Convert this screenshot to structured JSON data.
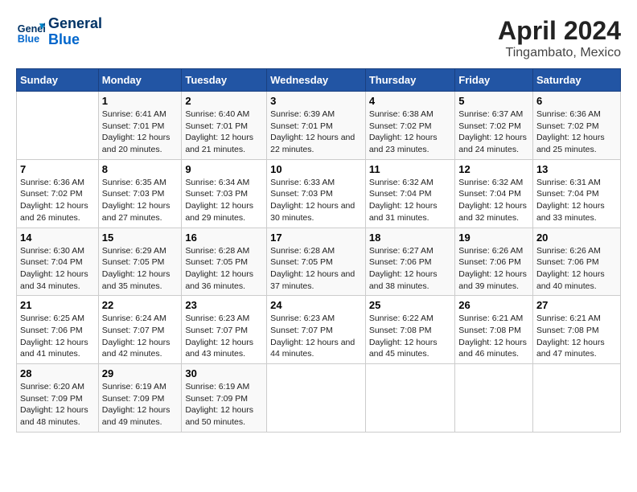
{
  "header": {
    "logo_line1": "General",
    "logo_line2": "Blue",
    "title": "April 2024",
    "subtitle": "Tingambato, Mexico"
  },
  "calendar": {
    "days_of_week": [
      "Sunday",
      "Monday",
      "Tuesday",
      "Wednesday",
      "Thursday",
      "Friday",
      "Saturday"
    ],
    "weeks": [
      [
        {
          "day": "",
          "info": ""
        },
        {
          "day": "1",
          "info": "Sunrise: 6:41 AM\nSunset: 7:01 PM\nDaylight: 12 hours\nand 20 minutes."
        },
        {
          "day": "2",
          "info": "Sunrise: 6:40 AM\nSunset: 7:01 PM\nDaylight: 12 hours\nand 21 minutes."
        },
        {
          "day": "3",
          "info": "Sunrise: 6:39 AM\nSunset: 7:01 PM\nDaylight: 12 hours\nand 22 minutes."
        },
        {
          "day": "4",
          "info": "Sunrise: 6:38 AM\nSunset: 7:02 PM\nDaylight: 12 hours\nand 23 minutes."
        },
        {
          "day": "5",
          "info": "Sunrise: 6:37 AM\nSunset: 7:02 PM\nDaylight: 12 hours\nand 24 minutes."
        },
        {
          "day": "6",
          "info": "Sunrise: 6:36 AM\nSunset: 7:02 PM\nDaylight: 12 hours\nand 25 minutes."
        }
      ],
      [
        {
          "day": "7",
          "info": "Sunrise: 6:36 AM\nSunset: 7:02 PM\nDaylight: 12 hours\nand 26 minutes."
        },
        {
          "day": "8",
          "info": "Sunrise: 6:35 AM\nSunset: 7:03 PM\nDaylight: 12 hours\nand 27 minutes."
        },
        {
          "day": "9",
          "info": "Sunrise: 6:34 AM\nSunset: 7:03 PM\nDaylight: 12 hours\nand 29 minutes."
        },
        {
          "day": "10",
          "info": "Sunrise: 6:33 AM\nSunset: 7:03 PM\nDaylight: 12 hours\nand 30 minutes."
        },
        {
          "day": "11",
          "info": "Sunrise: 6:32 AM\nSunset: 7:04 PM\nDaylight: 12 hours\nand 31 minutes."
        },
        {
          "day": "12",
          "info": "Sunrise: 6:32 AM\nSunset: 7:04 PM\nDaylight: 12 hours\nand 32 minutes."
        },
        {
          "day": "13",
          "info": "Sunrise: 6:31 AM\nSunset: 7:04 PM\nDaylight: 12 hours\nand 33 minutes."
        }
      ],
      [
        {
          "day": "14",
          "info": "Sunrise: 6:30 AM\nSunset: 7:04 PM\nDaylight: 12 hours\nand 34 minutes."
        },
        {
          "day": "15",
          "info": "Sunrise: 6:29 AM\nSunset: 7:05 PM\nDaylight: 12 hours\nand 35 minutes."
        },
        {
          "day": "16",
          "info": "Sunrise: 6:28 AM\nSunset: 7:05 PM\nDaylight: 12 hours\nand 36 minutes."
        },
        {
          "day": "17",
          "info": "Sunrise: 6:28 AM\nSunset: 7:05 PM\nDaylight: 12 hours\nand 37 minutes."
        },
        {
          "day": "18",
          "info": "Sunrise: 6:27 AM\nSunset: 7:06 PM\nDaylight: 12 hours\nand 38 minutes."
        },
        {
          "day": "19",
          "info": "Sunrise: 6:26 AM\nSunset: 7:06 PM\nDaylight: 12 hours\nand 39 minutes."
        },
        {
          "day": "20",
          "info": "Sunrise: 6:26 AM\nSunset: 7:06 PM\nDaylight: 12 hours\nand 40 minutes."
        }
      ],
      [
        {
          "day": "21",
          "info": "Sunrise: 6:25 AM\nSunset: 7:06 PM\nDaylight: 12 hours\nand 41 minutes."
        },
        {
          "day": "22",
          "info": "Sunrise: 6:24 AM\nSunset: 7:07 PM\nDaylight: 12 hours\nand 42 minutes."
        },
        {
          "day": "23",
          "info": "Sunrise: 6:23 AM\nSunset: 7:07 PM\nDaylight: 12 hours\nand 43 minutes."
        },
        {
          "day": "24",
          "info": "Sunrise: 6:23 AM\nSunset: 7:07 PM\nDaylight: 12 hours\nand 44 minutes."
        },
        {
          "day": "25",
          "info": "Sunrise: 6:22 AM\nSunset: 7:08 PM\nDaylight: 12 hours\nand 45 minutes."
        },
        {
          "day": "26",
          "info": "Sunrise: 6:21 AM\nSunset: 7:08 PM\nDaylight: 12 hours\nand 46 minutes."
        },
        {
          "day": "27",
          "info": "Sunrise: 6:21 AM\nSunset: 7:08 PM\nDaylight: 12 hours\nand 47 minutes."
        }
      ],
      [
        {
          "day": "28",
          "info": "Sunrise: 6:20 AM\nSunset: 7:09 PM\nDaylight: 12 hours\nand 48 minutes."
        },
        {
          "day": "29",
          "info": "Sunrise: 6:19 AM\nSunset: 7:09 PM\nDaylight: 12 hours\nand 49 minutes."
        },
        {
          "day": "30",
          "info": "Sunrise: 6:19 AM\nSunset: 7:09 PM\nDaylight: 12 hours\nand 50 minutes."
        },
        {
          "day": "",
          "info": ""
        },
        {
          "day": "",
          "info": ""
        },
        {
          "day": "",
          "info": ""
        },
        {
          "day": "",
          "info": ""
        }
      ]
    ]
  }
}
